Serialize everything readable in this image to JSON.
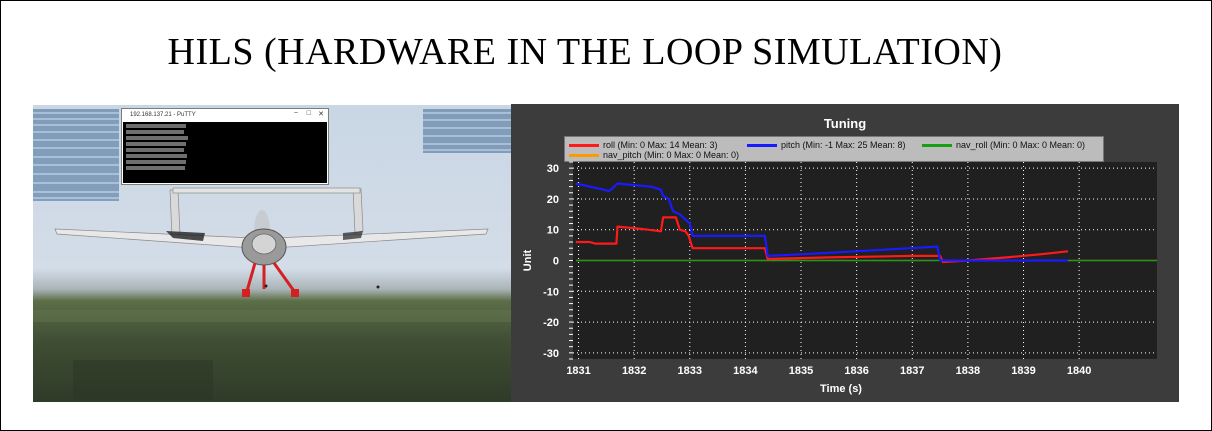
{
  "page": {
    "title": "HILS (HARDWARE IN THE LOOP SIMULATION)"
  },
  "simulator": {
    "terminal_title": "192.168.137.21 - PuTTY",
    "terminal_controls": [
      "−",
      "□",
      "✕"
    ],
    "colors": {
      "sky": "#cfd9e5",
      "ground": "#3e4d33",
      "landing_gear": "#d42020",
      "airframe": "#e6e6e6"
    }
  },
  "chart_data": {
    "type": "line",
    "title": "Tuning",
    "xlabel": "Time (s)",
    "ylabel": "Unit",
    "xlim": [
      1830.9,
      1841.4
    ],
    "ylim": [
      -32,
      32
    ],
    "xticks": [
      1831,
      1832,
      1833,
      1834,
      1835,
      1836,
      1837,
      1838,
      1839,
      1840
    ],
    "yticks": [
      30,
      20,
      10,
      0,
      -10,
      -20,
      -30
    ],
    "grid": true,
    "legend_position": "top",
    "series": [
      {
        "name": "roll (Min: 0 Max: 14 Mean: 3)",
        "color": "#ff1a1a",
        "x": [
          1830.95,
          1831.2,
          1831.3,
          1831.68,
          1831.7,
          1832.0,
          1832.25,
          1832.48,
          1832.52,
          1832.75,
          1832.82,
          1832.92,
          1832.98,
          1833.05,
          1834.35,
          1834.4,
          1835.5,
          1837.0,
          1837.5,
          1837.55,
          1838.0,
          1838.7,
          1839.3,
          1839.8
        ],
        "values": [
          6,
          6,
          5.5,
          5.5,
          11,
          10.5,
          10,
          9.5,
          14,
          14,
          10,
          9.5,
          8,
          4,
          4,
          0.5,
          1,
          1.5,
          1.5,
          -0.5,
          0,
          1,
          2,
          3
        ]
      },
      {
        "name": "pitch (Min: -1 Max: 25 Mean: 8)",
        "color": "#1a1aff",
        "x": [
          1830.95,
          1831.2,
          1831.45,
          1831.55,
          1831.7,
          1832.0,
          1832.3,
          1832.48,
          1832.52,
          1832.62,
          1832.7,
          1832.82,
          1833.0,
          1833.05,
          1834.35,
          1834.4,
          1835.0,
          1836.5,
          1837.45,
          1837.5,
          1838.0,
          1839.8
        ],
        "values": [
          25,
          24,
          23,
          22.5,
          25,
          24.5,
          24,
          23,
          21,
          20,
          16,
          15,
          12,
          8,
          8,
          1.5,
          2,
          3.5,
          4.5,
          0,
          0,
          0
        ]
      },
      {
        "name": "nav_roll (Min: 0 Max: 0 Mean: 0)",
        "color": "#15a015",
        "x": [
          1830.95,
          1841.4
        ],
        "values": [
          0,
          0
        ]
      },
      {
        "name": "nav_pitch (Min: 0 Max: 0 Mean: 0)",
        "color": "#ff9900",
        "x": [
          1830.95,
          1841.4
        ],
        "values": [
          0,
          0
        ]
      }
    ]
  }
}
